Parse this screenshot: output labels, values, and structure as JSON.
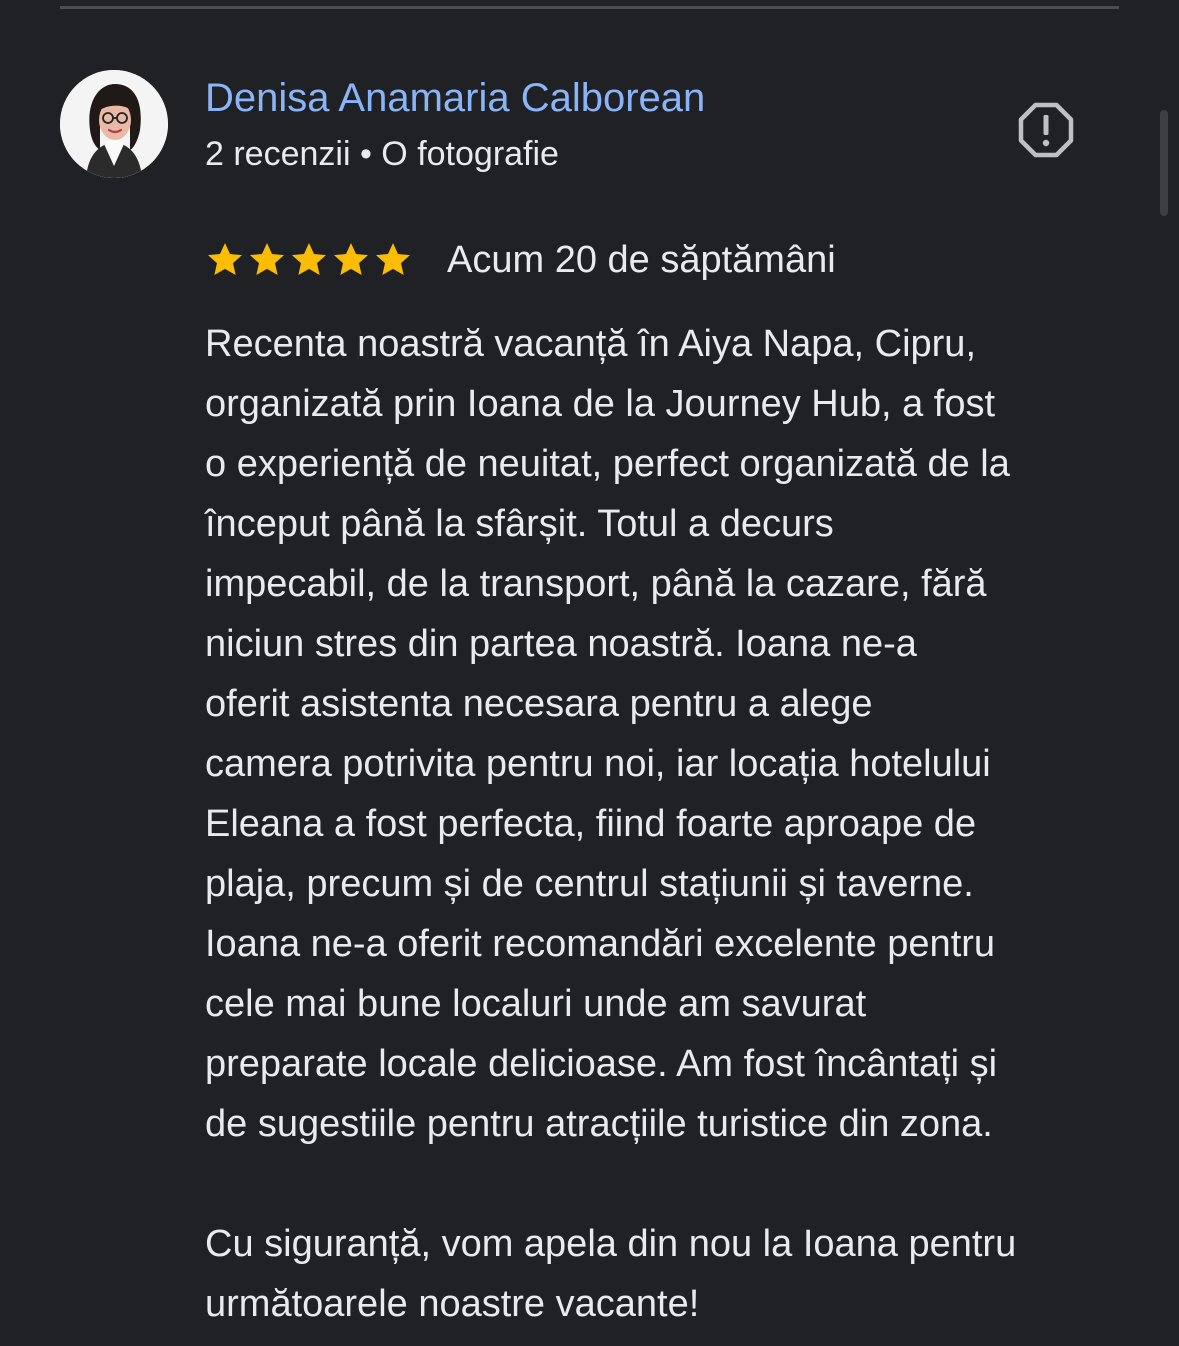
{
  "review": {
    "author": {
      "name": "Denisa Anamaria Calborean",
      "meta": "2 recenzii • O fotografie"
    },
    "rating": {
      "stars": 5,
      "max_stars": 5,
      "star_color": "#fbbc04"
    },
    "date": "Acum 20 de săptămâni",
    "text": "Recenta noastră vacanță în Aiya Napa, Cipru,\norganizată prin Ioana de la Journey Hub, a fost\no experiență de neuitat, perfect organizată de la\nînceput până la sfârșit. Totul a decurs\nimpecabil, de la transport, până la cazare, fără\nniciun stres din partea noastră. Ioana ne-a\noferit asistenta necesara pentru a alege\ncamera potrivita pentru noi, iar locația hotelului\nEleana a fost perfecta, fiind foarte aproape de\nplaja, precum și de centrul stațiunii și taverne.\nIoana ne-a oferit recomandări excelente pentru\ncele mai bune localuri unde am savurat\npreparate locale delicioase. Am fost încântați și\nde sugestiile pentru atracțiile turistice din zona.\n\nCu siguranță, vom apela din nou la Ioana pentru\nurmătoarele noastre vacante!"
  },
  "icons": {
    "report": "report-flag-icon",
    "star": "star-icon"
  },
  "colors": {
    "background": "#202124",
    "author_name": "#8ab4f8",
    "text": "#e8eaed",
    "icon": "#bdc1c6"
  }
}
